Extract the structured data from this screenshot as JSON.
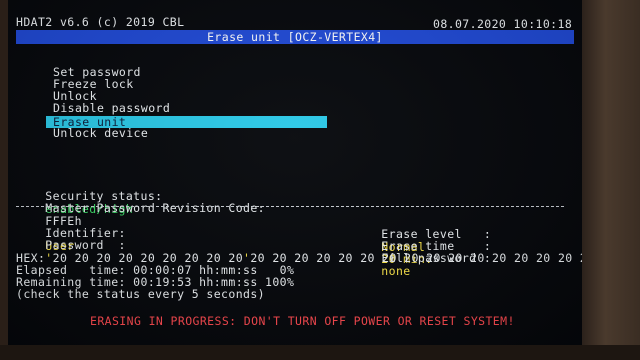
{
  "header": {
    "app": "HDAT2 v6.6 (c) 2019 CBL",
    "datetime": "08.07.2020 10:10:18"
  },
  "window": {
    "title": "Erase unit [OCZ-VERTEX4]"
  },
  "menu": {
    "items": [
      {
        "label": "Set password"
      },
      {
        "label": "Freeze lock"
      },
      {
        "label": "Unlock"
      },
      {
        "label": "Disable password"
      },
      {
        "label": "Erase unit"
      },
      {
        "label": "Unlock device"
      }
    ],
    "selected_index": 4
  },
  "security": {
    "status_label": "Security status:",
    "status_value": "enabled/high",
    "master_label": "Master Password Revision Code:",
    "master_value": "FFFEh"
  },
  "params": {
    "identifier_label": "Identifier:",
    "identifier_value": "User",
    "password_label": "Password  :",
    "password_value": "'                          '",
    "erase_level_label": "Erase level   :",
    "erase_level_value": "Normal",
    "erase_time_label": "Erase time    :",
    "erase_time_value": "20 min.",
    "fill_password_label": "Fill password :",
    "fill_password_value": "none"
  },
  "progress": {
    "hex": "HEX: 20 20 20 20 20 20 20 20 20 20 20 20 20 20 20 20 20 20 20 20 20 20 20 20 20 20",
    "elapsed": "Elapsed   time: 00:00:07 hh:mm:ss   0%",
    "remaining": "Remaining time: 00:19:53 hh:mm:ss 100%",
    "check": "(check the status every 5 seconds)"
  },
  "warning": "ERASING IN PROGRESS: DON'T TURN OFF POWER OR RESET SYSTEM!",
  "colors": {
    "title_bar": "#1f49d6",
    "selection": "#2ac9e8",
    "value_yellow": "#ffe94a",
    "status_green": "#3ee06a",
    "warning_red": "#ff4a50"
  }
}
